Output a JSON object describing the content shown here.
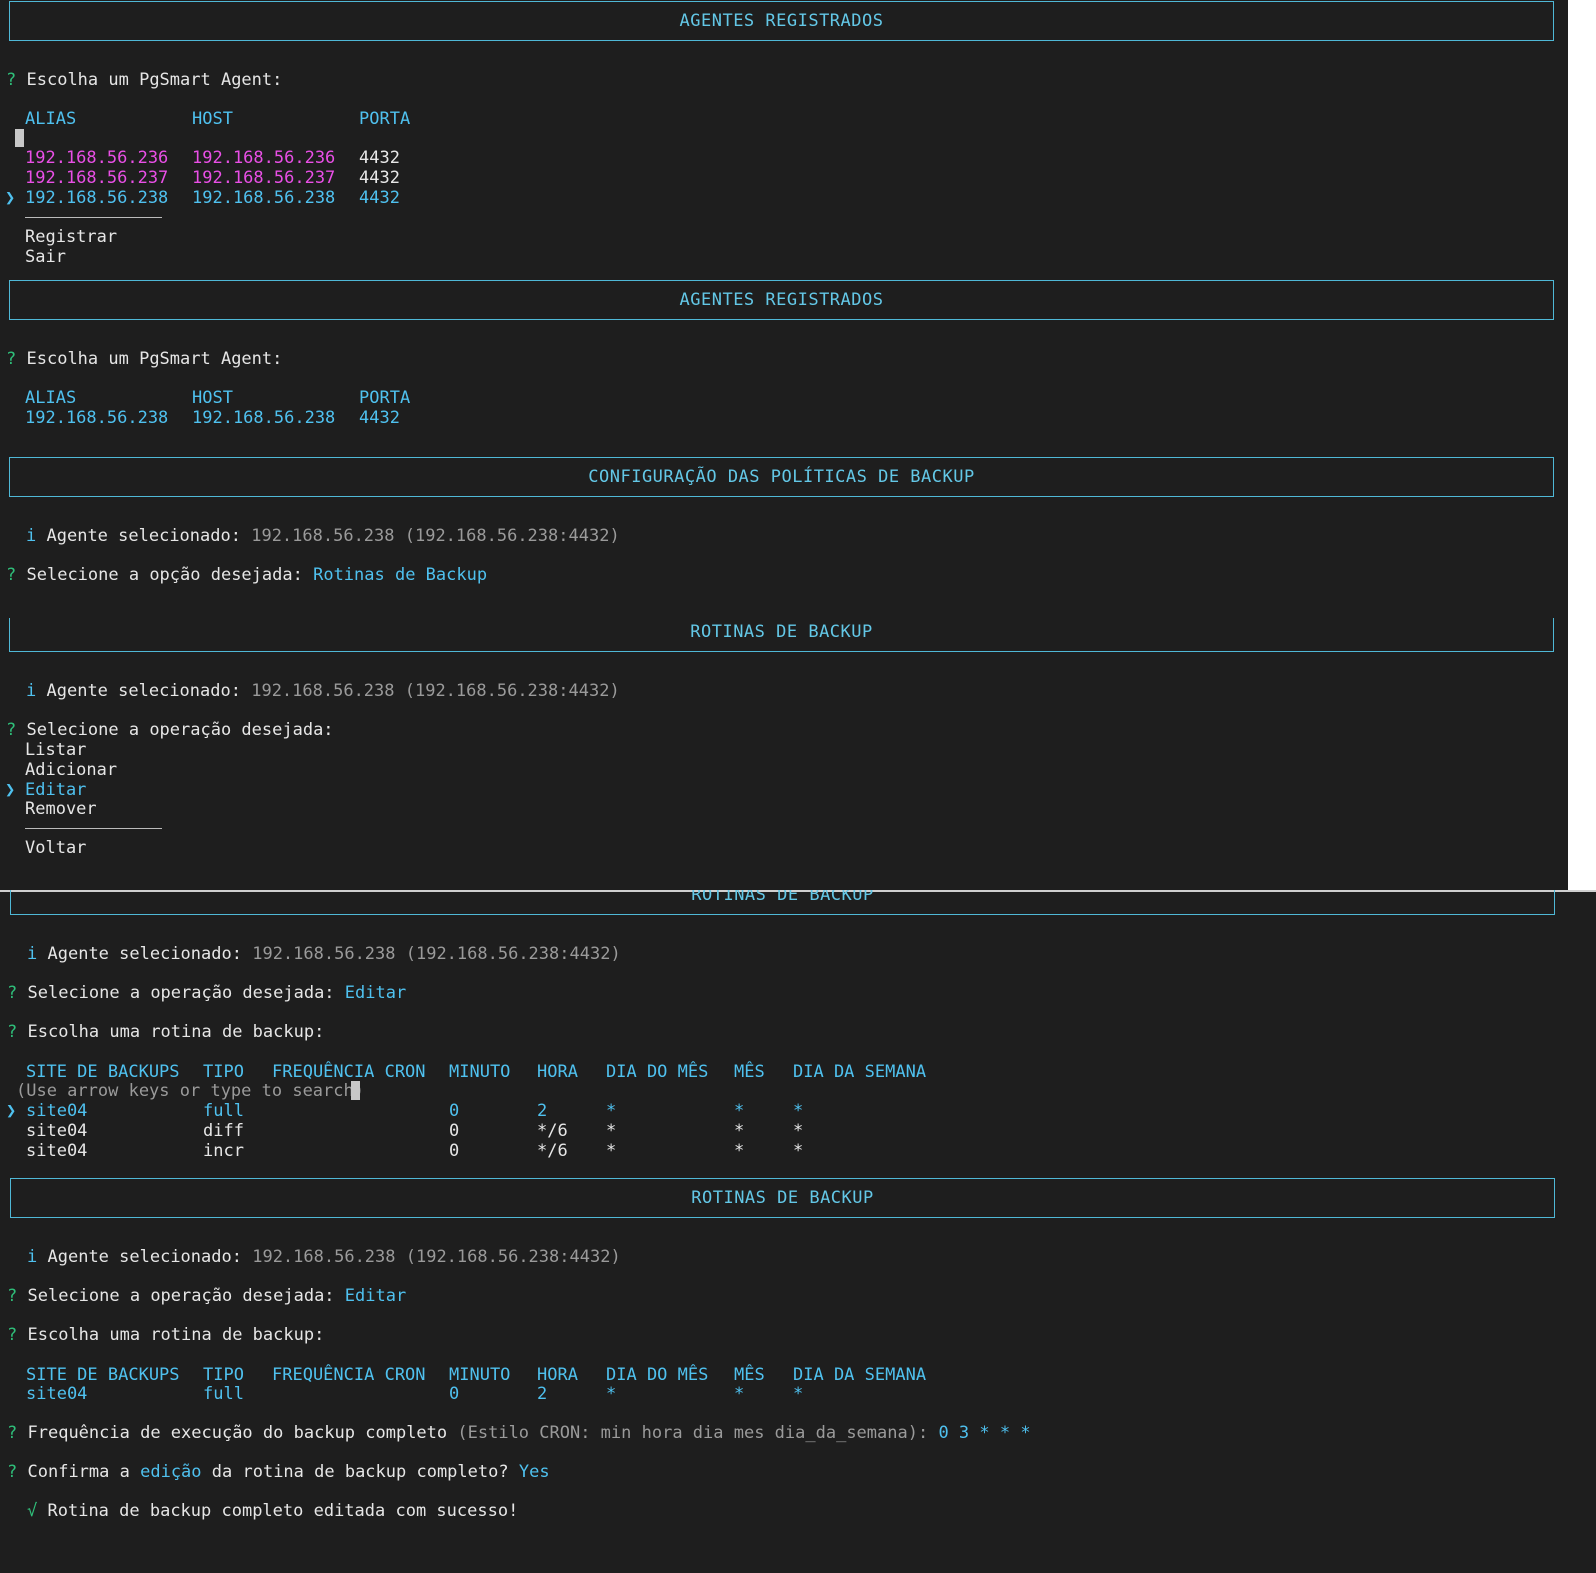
{
  "s1": {
    "header": "AGENTES REGISTRADOS",
    "prompt_mark": "?",
    "prompt": "Escolha um PgSmart Agent:",
    "columns": [
      "ALIAS",
      "HOST",
      "PORTA"
    ],
    "rows": [
      {
        "alias": "192.168.56.236",
        "host": "192.168.56.236",
        "port": "4432"
      },
      {
        "alias": "192.168.56.237",
        "host": "192.168.56.237",
        "port": "4432"
      },
      {
        "alias": "192.168.56.238",
        "host": "192.168.56.238",
        "port": "4432"
      }
    ],
    "pointer": "❯",
    "extra_options": [
      "Registrar",
      "Sair"
    ],
    "header2": "AGENTES REGISTRADOS",
    "prompt2": "Escolha um PgSmart Agent:",
    "selected_row": {
      "alias": "192.168.56.238",
      "host": "192.168.56.238",
      "port": "4432"
    },
    "header3": "CONFIGURAÇÃO DAS POLÍTICAS DE BACKUP",
    "info_mark": "i",
    "info_label": "Agente selecionado:",
    "info_value": "192.168.56.238 (192.168.56.238:4432)",
    "option_prompt": "Selecione a opção desejada:",
    "option_answer": "Rotinas de Backup"
  },
  "s2": {
    "header": "ROTINAS DE BACKUP",
    "info_mark": "i",
    "info_label": "Agente selecionado:",
    "info_value": "192.168.56.238 (192.168.56.238:4432)",
    "prompt": "Selecione a operação desejada:",
    "options": [
      "Listar",
      "Adicionar",
      "Editar",
      "Remover"
    ],
    "pointer": "❯",
    "back_option": "Voltar"
  },
  "s3": {
    "header": "ROTINAS DE BACKUP",
    "info_mark": "i",
    "info_label": "Agente selecionado:",
    "info_value": "192.168.56.238 (192.168.56.238:4432)",
    "op_prompt": "Selecione a operação desejada:",
    "op_answer": "Editar",
    "routine_prompt": "Escolha uma rotina de backup:",
    "columns": [
      "SITE DE BACKUPS",
      "TIPO",
      "FREQUÊNCIA CRON",
      "MINUTO",
      "HORA",
      "DIA DO MÊS",
      "MÊS",
      "DIA DA SEMANA"
    ],
    "search_hint": "(Use arrow keys or type to search)",
    "pointer": "❯",
    "rows": [
      {
        "site": "site04",
        "tipo": "full",
        "minuto": "0",
        "hora": "2",
        "dia_mes": "*",
        "mes": "*",
        "dia_semana": "*"
      },
      {
        "site": "site04",
        "tipo": "diff",
        "minuto": "0",
        "hora": "*/6",
        "dia_mes": "*",
        "mes": "*",
        "dia_semana": "*"
      },
      {
        "site": "site04",
        "tipo": "incr",
        "minuto": "0",
        "hora": "*/6",
        "dia_mes": "*",
        "mes": "*",
        "dia_semana": "*"
      }
    ],
    "header2": "ROTINAS DE BACKUP",
    "selected_row": {
      "site": "site04",
      "tipo": "full",
      "minuto": "0",
      "hora": "2",
      "dia_mes": "*",
      "mes": "*",
      "dia_semana": "*"
    },
    "freq_prompt": "Frequência de execução do backup completo",
    "freq_hint": "(Estilo CRON: min hora dia mes dia_da_semana):",
    "freq_answer": "0 3 * * *",
    "confirm_prefix": "Confirma a",
    "confirm_highlight": "edição",
    "confirm_suffix": "da rotina de backup completo?",
    "confirm_answer": "Yes",
    "success_mark": "√",
    "success_msg": "Rotina de backup completo editada com sucesso!"
  },
  "colors": {
    "background": "#1e1e1e",
    "accent": "#4fc1ef",
    "magenta": "#e94fe6",
    "prompt_mark": "#2fbf7a",
    "muted": "#9a9a9a"
  }
}
